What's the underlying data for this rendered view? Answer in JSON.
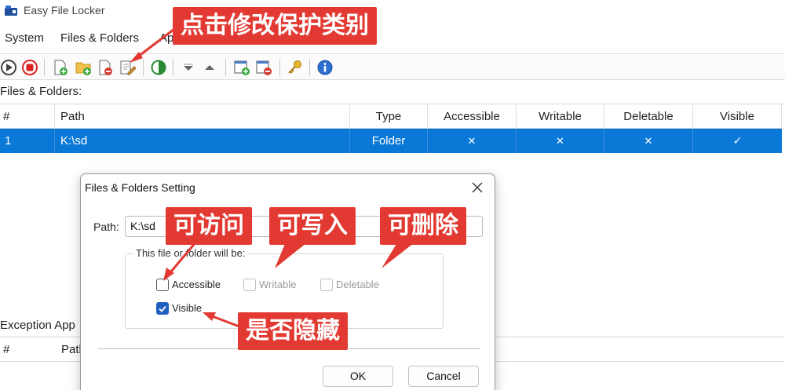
{
  "window": {
    "title": "Easy File Locker"
  },
  "menu": {
    "items": [
      "System",
      "Files & Folders",
      "Ap"
    ]
  },
  "toolbar": {
    "icons": [
      "start-icon",
      "stop-icon",
      "add-file-icon",
      "add-folder-icon",
      "delete-item-icon",
      "edit-item-icon",
      "toggle-contrast-icon",
      "move-down-icon",
      "move-up-icon",
      "add-exception-icon",
      "remove-exception-icon",
      "key-icon",
      "info-icon"
    ]
  },
  "files_section": {
    "label": "Files & Folders:"
  },
  "grid": {
    "columns": [
      "#",
      "Path",
      "Type",
      "Accessible",
      "Writable",
      "Deletable",
      "Visible"
    ],
    "rows": [
      {
        "num": "1",
        "path": "K:\\sd",
        "type": "Folder",
        "accessible": "✕",
        "writable": "✕",
        "deletable": "✕",
        "visible": "✓"
      }
    ]
  },
  "exception_section": {
    "label": "Exception App",
    "columns": [
      "#",
      "Path"
    ]
  },
  "dialog": {
    "title": "Files & Folders Setting",
    "path_label": "Path:",
    "path_value": "K:\\sd",
    "group_title": "This file or folder will be:",
    "options": {
      "accessible": {
        "label": "Accessible",
        "checked": false,
        "enabled": true
      },
      "writable": {
        "label": "Writable",
        "checked": false,
        "enabled": false
      },
      "deletable": {
        "label": "Deletable",
        "checked": false,
        "enabled": false
      },
      "visible": {
        "label": "Visible",
        "checked": true,
        "enabled": true
      }
    },
    "ok_label": "OK",
    "cancel_label": "Cancel"
  },
  "annotations": {
    "top": "点击修改保护类别",
    "accessible": "可访问",
    "writable": "可写入",
    "deletable": "可删除",
    "visible": "是否隐藏"
  },
  "colors": {
    "selection": "#0a78d7",
    "callout": "#e23a33",
    "checked": "#1f5fbf"
  }
}
